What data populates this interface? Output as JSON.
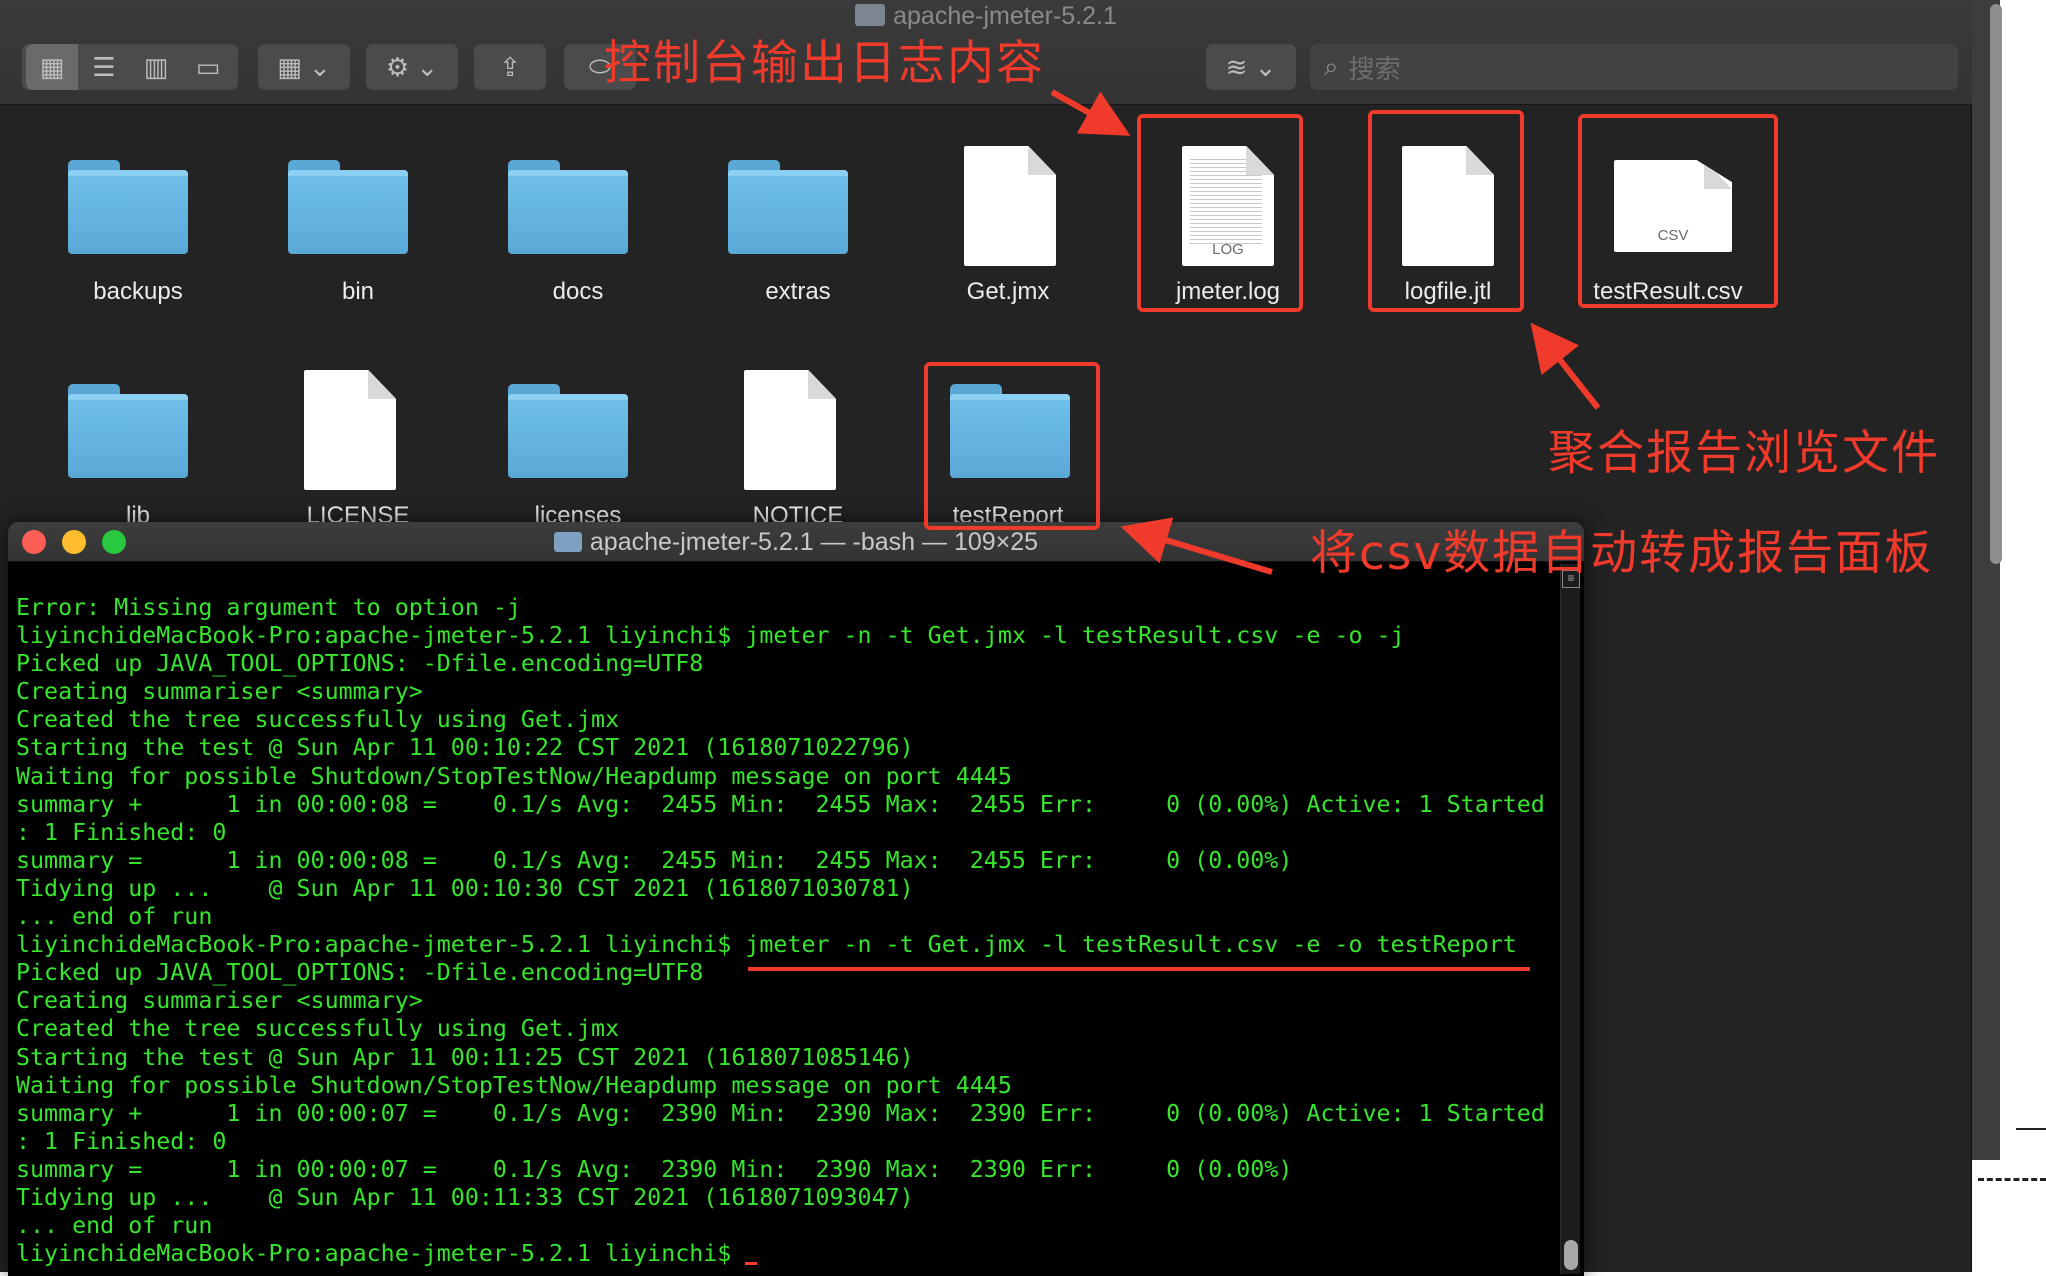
{
  "finder": {
    "title": "apache-jmeter-5.2.1",
    "search_placeholder": "搜索",
    "toolbar": {
      "view_icon": "icon-view",
      "list_icon": "list-view",
      "column_icon": "column-view",
      "gallery_icon": "gallery-view",
      "group_icon": "group-by",
      "action_icon": "gear",
      "share_icon": "share",
      "tag_icon": "tag",
      "path_icon": "path"
    },
    "items": [
      {
        "name": "backups",
        "kind": "folder"
      },
      {
        "name": "bin",
        "kind": "folder"
      },
      {
        "name": "docs",
        "kind": "folder"
      },
      {
        "name": "extras",
        "kind": "folder"
      },
      {
        "name": "Get.jmx",
        "kind": "file"
      },
      {
        "name": "jmeter.log",
        "kind": "log",
        "ext": "LOG"
      },
      {
        "name": "logfile.jtl",
        "kind": "file"
      },
      {
        "name": "testResult.csv",
        "kind": "csv",
        "ext": "CSV"
      },
      {
        "name": "lib",
        "kind": "folder"
      },
      {
        "name": "LICENSE",
        "kind": "file"
      },
      {
        "name": "licenses",
        "kind": "folder"
      },
      {
        "name": "NOTICE",
        "kind": "file"
      },
      {
        "name": "testReport",
        "kind": "folder"
      }
    ]
  },
  "terminal": {
    "title": "apache-jmeter-5.2.1 — -bash — 109×25",
    "lines": [
      "Error: Missing argument to option -j",
      "liyinchideMacBook-Pro:apache-jmeter-5.2.1 liyinchi$ jmeter -n -t Get.jmx -l testResult.csv -e -o -j",
      "Picked up JAVA_TOOL_OPTIONS: -Dfile.encoding=UTF8",
      "Creating summariser <summary>",
      "Created the tree successfully using Get.jmx",
      "Starting the test @ Sun Apr 11 00:10:22 CST 2021 (1618071022796)",
      "Waiting for possible Shutdown/StopTestNow/Heapdump message on port 4445",
      "summary +      1 in 00:00:08 =    0.1/s Avg:  2455 Min:  2455 Max:  2455 Err:     0 (0.00%) Active: 1 Started",
      ": 1 Finished: 0",
      "summary =      1 in 00:00:08 =    0.1/s Avg:  2455 Min:  2455 Max:  2455 Err:     0 (0.00%)",
      "Tidying up ...    @ Sun Apr 11 00:10:30 CST 2021 (1618071030781)",
      "... end of run",
      "liyinchideMacBook-Pro:apache-jmeter-5.2.1 liyinchi$ jmeter -n -t Get.jmx -l testResult.csv -e -o testReport",
      "Picked up JAVA_TOOL_OPTIONS: -Dfile.encoding=UTF8",
      "Creating summariser <summary>",
      "Created the tree successfully using Get.jmx",
      "Starting the test @ Sun Apr 11 00:11:25 CST 2021 (1618071085146)",
      "Waiting for possible Shutdown/StopTestNow/Heapdump message on port 4445",
      "summary +      1 in 00:00:07 =    0.1/s Avg:  2390 Min:  2390 Max:  2390 Err:     0 (0.00%) Active: 1 Started",
      ": 1 Finished: 0",
      "summary =      1 in 00:00:07 =    0.1/s Avg:  2390 Min:  2390 Max:  2390 Err:     0 (0.00%)",
      "Tidying up ...    @ Sun Apr 11 00:11:33 CST 2021 (1618071093047)",
      "... end of run"
    ],
    "prompt": "liyinchideMacBook-Pro:apache-jmeter-5.2.1 liyinchi$ "
  },
  "annotations": {
    "log_label": "控制台输出日志内容",
    "jtl_label": "聚合报告浏览文件",
    "report_label": "将csv数据自动转成报告面板"
  },
  "colors": {
    "annotation": "#f03a2c",
    "terminal_text": "#37e42e",
    "folder": "#5aa8d6"
  }
}
